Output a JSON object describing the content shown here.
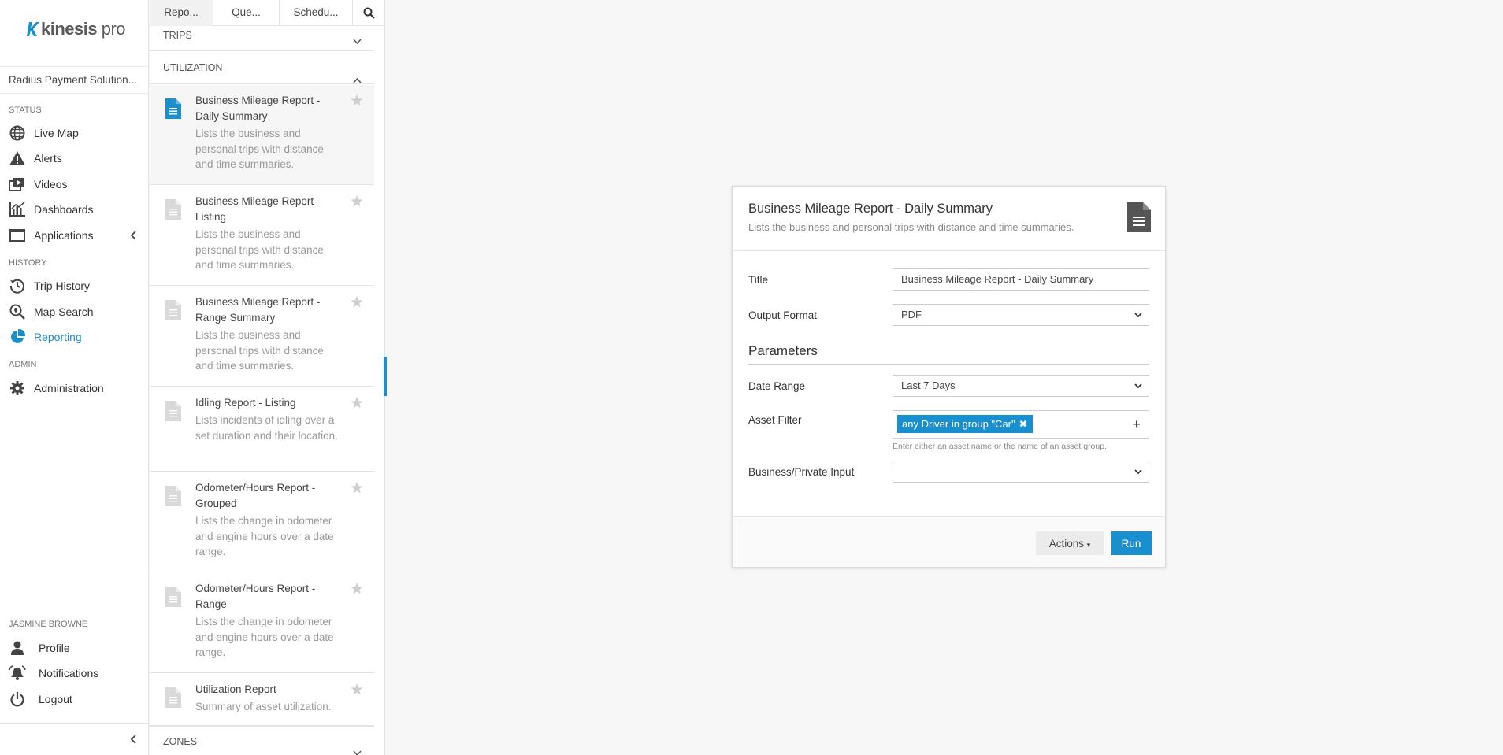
{
  "brand": {
    "logo_text_bold": "kinesis",
    "logo_text_light": " pro",
    "accent": "#1a8fd0"
  },
  "nav": {
    "organization": "Radius Payment Solution...",
    "sections": {
      "status": "STATUS",
      "history": "HISTORY",
      "admin": "ADMIN",
      "user": "JASMINE BROWNE"
    },
    "items": {
      "live_map": "Live Map",
      "alerts": "Alerts",
      "videos": "Videos",
      "dashboards": "Dashboards",
      "applications": "Applications",
      "trip_history": "Trip History",
      "map_search": "Map Search",
      "reporting": "Reporting",
      "administration": "Administration",
      "profile": "Profile",
      "notifications": "Notifications",
      "logout": "Logout"
    }
  },
  "list": {
    "tabs": [
      "Repo...",
      "Que...",
      "Schedu..."
    ],
    "categories": {
      "trips": "TRIPS",
      "utilization": "UTILIZATION",
      "zones": "ZONES"
    },
    "reports": [
      {
        "name": "Business Mileage Report - Daily Summary",
        "desc": "Lists the business and personal trips with distance and time summaries."
      },
      {
        "name": "Business Mileage Report - Listing",
        "desc": "Lists the business and personal trips with distance and time summaries."
      },
      {
        "name": "Business Mileage Report - Range Summary",
        "desc": "Lists the business and personal trips with distance and time summaries."
      },
      {
        "name": "Idling Report - Listing",
        "desc": "Lists incidents of idling over a set duration and their location."
      },
      {
        "name": "Odometer/Hours Report - Grouped",
        "desc": "Lists the change in odometer and engine hours over a date range."
      },
      {
        "name": "Odometer/Hours Report - Range",
        "desc": "Lists the change in odometer and engine hours over a date range."
      },
      {
        "name": "Utilization Report",
        "desc": "Summary of asset utilization."
      }
    ]
  },
  "dialog": {
    "title": "Business Mileage Report - Daily Summary",
    "subtitle": "Lists the business and personal trips with distance and time summaries.",
    "fields": {
      "title_label": "Title",
      "title_value": "Business Mileage Report - Daily Summary",
      "format_label": "Output Format",
      "format_value": "PDF",
      "parameters_heading": "Parameters",
      "date_label": "Date Range",
      "date_value": "Last 7 Days",
      "asset_label": "Asset Filter",
      "asset_tag": "any Driver in group \"Car\"",
      "asset_help": "Enter either an asset name or the name of an asset group.",
      "bp_label": "Business/Private Input",
      "bp_value": ""
    },
    "actions_label": "Actions",
    "run_label": "Run"
  }
}
